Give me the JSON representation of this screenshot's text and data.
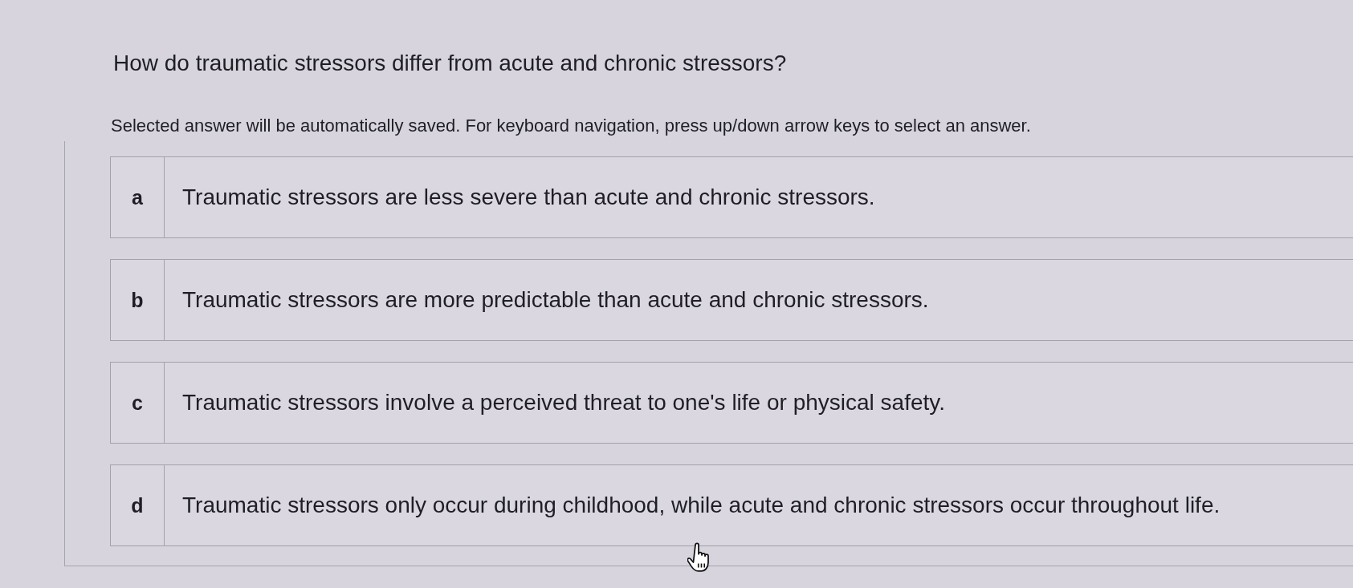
{
  "question": {
    "text": "How do traumatic stressors differ from acute and chronic stressors?"
  },
  "instructions": "Selected answer will be automatically saved. For keyboard navigation, press up/down arrow keys to select an answer.",
  "options": [
    {
      "letter": "a",
      "text": "Traumatic stressors are less severe than acute and chronic stressors.",
      "selected": false
    },
    {
      "letter": "b",
      "text": "Traumatic stressors are more predictable than acute and chronic stressors.",
      "selected": false
    },
    {
      "letter": "c",
      "text": "Traumatic stressors involve a perceived threat to one's life or physical safety.",
      "selected": false
    },
    {
      "letter": "d",
      "text": "Traumatic stressors only occur during childhood, while acute and chronic stressors occur throughout life.",
      "selected": false
    }
  ]
}
